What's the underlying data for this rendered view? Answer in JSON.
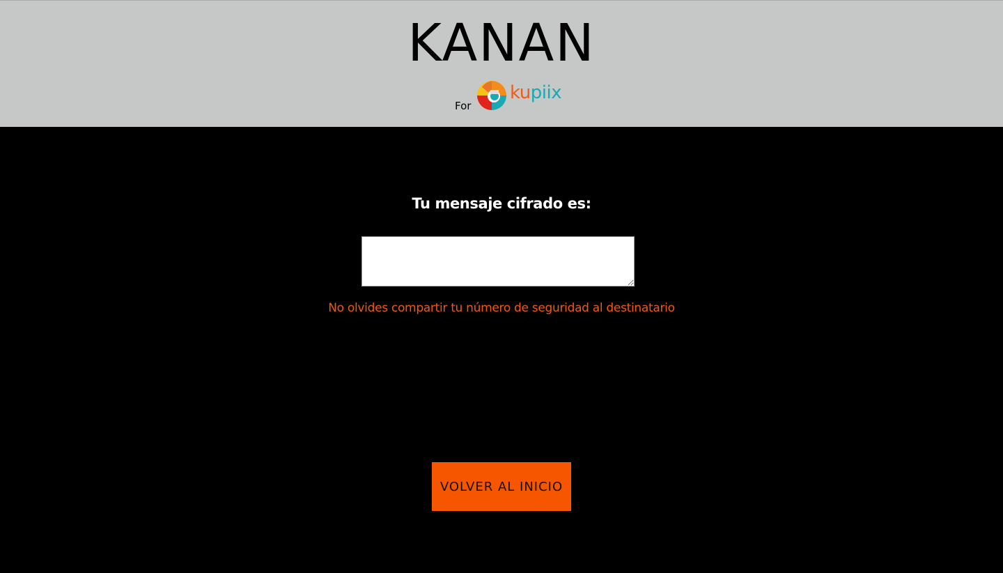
{
  "header": {
    "title": "KANAN",
    "for_label": "For",
    "partner_logo": {
      "icon": "kupiix-logo-icon",
      "word_part1": "ku",
      "word_part2": "piix",
      "colors": {
        "orange": "#f05a1a",
        "teal": "#1aa8b5",
        "yellow": "#f6c21a",
        "red": "#e0241b"
      }
    }
  },
  "main": {
    "result_label": "Tu mensaje cifrado es:",
    "cipher_text": "",
    "warning": "No olvides compartir tu número de seguridad al destinatario",
    "back_button_label": "VOLVER AL INICIO"
  },
  "colors": {
    "header_bg": "#c6c8c7",
    "page_bg": "#000000",
    "accent": "#f65600",
    "warning_text": "#f4580a"
  }
}
